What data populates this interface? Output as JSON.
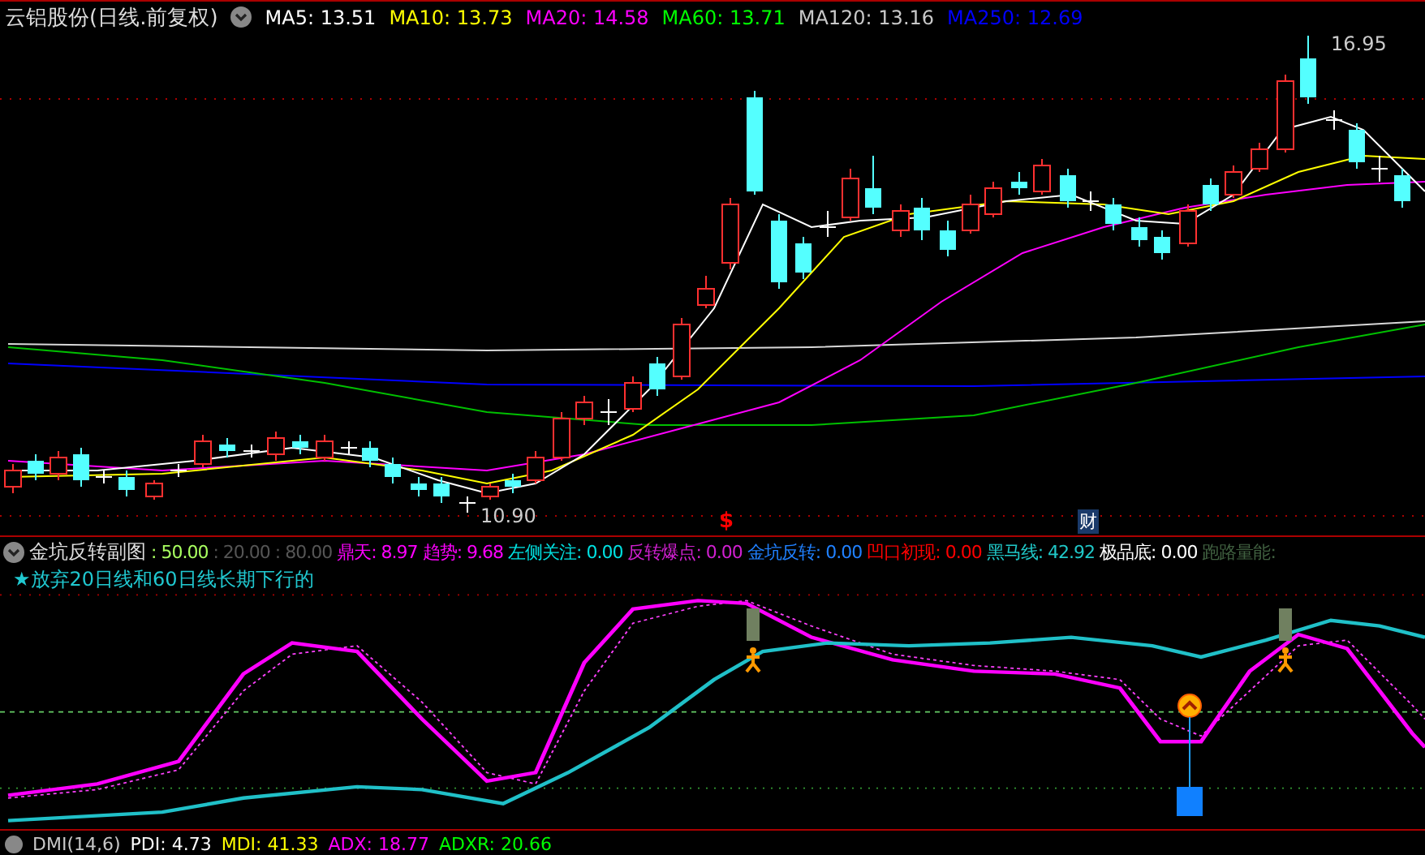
{
  "header": {
    "title": "云铝股份(日线.前复权)",
    "averages": [
      {
        "text": "MA5: 13.51",
        "color": "#ffffff"
      },
      {
        "text": "MA10: 13.73",
        "color": "#ffff00"
      },
      {
        "text": "MA20: 14.58",
        "color": "#ff00ff"
      },
      {
        "text": "MA60: 13.71",
        "color": "#00ff00"
      },
      {
        "text": "MA120: 13.16",
        "color": "#c8c8c8"
      },
      {
        "text": "MA250: 12.69",
        "color": "#0000ff"
      }
    ]
  },
  "price_chart": {
    "high_label": "16.95",
    "low_label": "10.90",
    "event_marks": [
      {
        "kind": "s",
        "text": "$"
      },
      {
        "kind": "cai",
        "text": "财"
      }
    ]
  },
  "indicator": {
    "title": "金坑反转副图",
    "subtitle": "★放弃20日线和60日线长期下行的",
    "items": [
      {
        "text": ": 50.00",
        "color": "#a8ff60"
      },
      {
        "text": ": 20.00",
        "color": "#555555"
      },
      {
        "text": ": 80.00",
        "color": "#555555"
      },
      {
        "text": "鼎天: 8.97",
        "color": "#ff00ff"
      },
      {
        "text": "趋势: 9.68",
        "color": "#ff00ff"
      },
      {
        "text": "左侧关注: 0.00",
        "color": "#00e0e0"
      },
      {
        "text": "反转爆点: 0.00",
        "color": "#d020d0"
      },
      {
        "text": "金坑反转: 0.00",
        "color": "#2080ff"
      },
      {
        "text": "凹口初现: 0.00",
        "color": "#ff0000"
      },
      {
        "text": "黑马线: 42.92",
        "color": "#20c8c8"
      },
      {
        "text": "极品底: 0.00",
        "color": "#ffffff"
      },
      {
        "text": "跑路量能:",
        "color": "#406040"
      }
    ]
  },
  "bottom_indicator": {
    "items": [
      {
        "text": "DMI(14,6)",
        "color": "#c8c8c8"
      },
      {
        "text": "PDI: 4.73",
        "color": "#ffffff"
      },
      {
        "text": "MDI: 41.33",
        "color": "#ffff00"
      },
      {
        "text": "ADX: 18.77",
        "color": "#ff00ff"
      },
      {
        "text": "ADXR: 20.66",
        "color": "#00ff00"
      }
    ]
  }
}
